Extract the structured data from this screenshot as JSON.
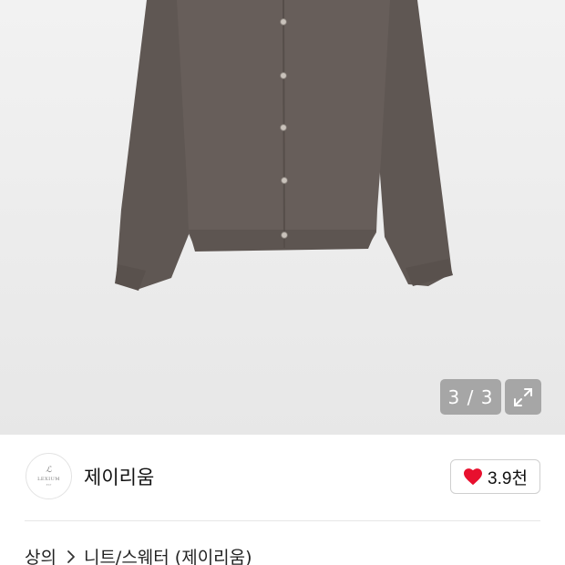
{
  "gallery": {
    "counter": "3 / 3",
    "product_image": "brown-knit-cardigan",
    "icons": {
      "expand": "expand-arrows-icon"
    }
  },
  "brand": {
    "logo_mark": "ℒ",
    "logo_text": "LEXIUM",
    "logo_sub": "EST",
    "name": "제이리움"
  },
  "like": {
    "icon": "heart-icon",
    "color": "#e8102e",
    "count": "3.9천"
  },
  "breadcrumb": {
    "category": "상의",
    "separator_icon": "chevron-right-icon",
    "subcategory": "니트/스웨터 (제이리움)"
  },
  "colors": {
    "cardigan": "#6b625e",
    "background": "#ececec",
    "overlay": "#8c8c8c"
  }
}
